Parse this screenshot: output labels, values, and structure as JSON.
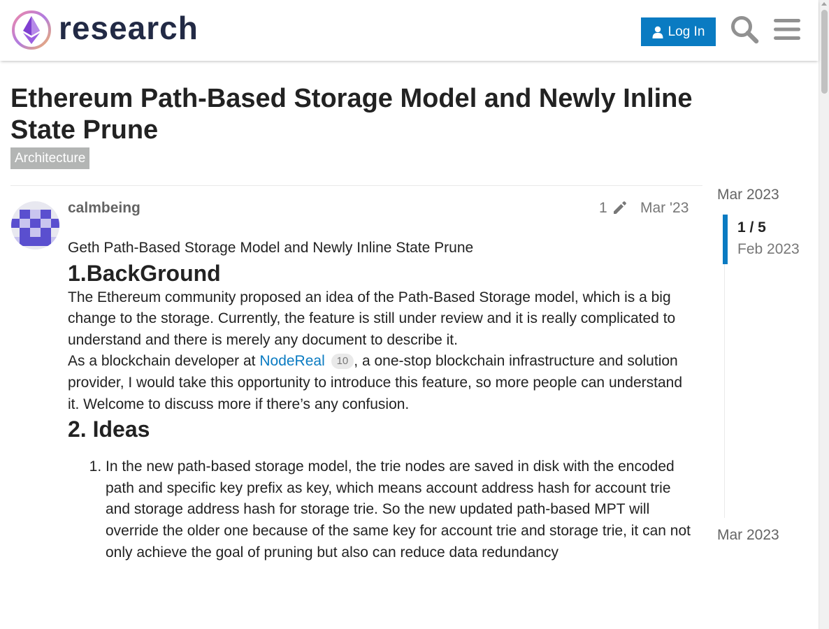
{
  "header": {
    "logo_text": "research",
    "login_label": "Log In",
    "colors": {
      "accent": "#0a7bc2",
      "logo_text": "#222a45"
    }
  },
  "topic": {
    "title": "Ethereum Path-Based Storage Model and Newly Inline State Prune",
    "category": "Architecture"
  },
  "post": {
    "username": "calmbeing",
    "edit_count": "1",
    "date": "Mar '23",
    "intro": "Geth Path-Based Storage Model and Newly Inline State Prune",
    "heading_background": "1.BackGround",
    "background_paragraph_1": "The Ethereum community proposed an idea of the Path-Based Storage model, which is a big change to the storage. Currently, the feature is still under review and it is really complicated to understand and there is merely any document to describe it.",
    "background_paragraph_2_start": "As a blockchain developer at ",
    "link_label": "NodeReal",
    "link_click_count": "10",
    "background_paragraph_2_end": ", a one-stop blockchain infrastructure and solution provider, I would take this opportunity to introduce this feature, so more people can understand it. Welcome to discuss more if there’s any confusion.",
    "heading_ideas": "2. Ideas",
    "ideas": [
      "In the new path-based storage model, the trie nodes are saved in disk with the encoded path and specific key prefix as key, which means account address hash for account trie and storage address hash for storage trie. So the new updated path-based MPT will override the older one because of the same key for account trie and storage trie, it can not only achieve the goal of pruning but also can reduce data redundancy"
    ]
  },
  "timeline": {
    "start_date": "Mar 2023",
    "position": "1 / 5",
    "position_date": "Feb 2023",
    "end_date": "Mar 2023"
  }
}
